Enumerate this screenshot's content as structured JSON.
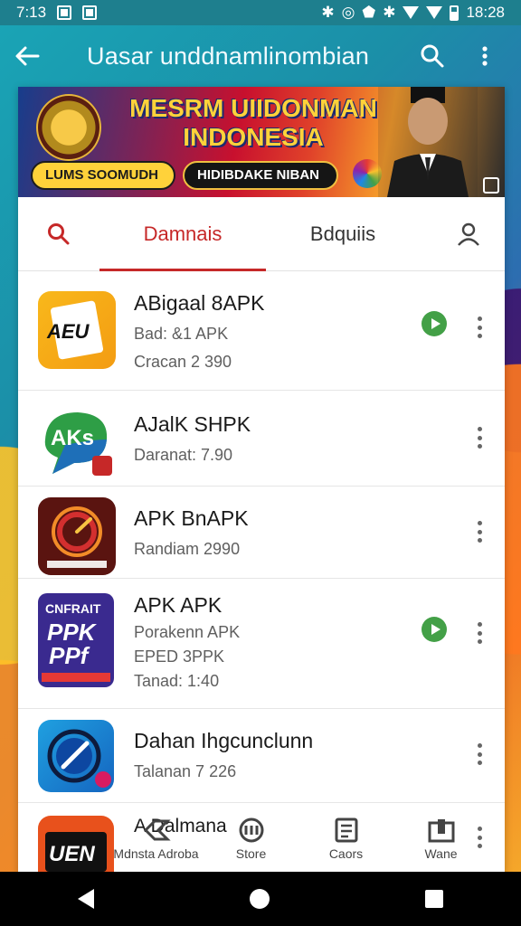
{
  "status_bar": {
    "time": "7:13",
    "clock": "18:28"
  },
  "app_bar": {
    "title": "Uasar unddnamlinombian"
  },
  "banner": {
    "title_line1": "MESRM UIIDONMAN",
    "title_line2": "INDONESIA",
    "chip_left": "LUMS SOOMUDH",
    "chip_right": "HIDIBDAKE NIBAN"
  },
  "tabs": [
    {
      "label": "Damnais"
    },
    {
      "label": "Bdquiis"
    }
  ],
  "apps": [
    {
      "name": "ABigaal 8APK",
      "sub1": "Bad: &1 APK",
      "sub2": "Cracan 2 390",
      "icon": "document-icon"
    },
    {
      "name": "AJalK SHPK",
      "sub1": "Daranat: 7.90",
      "icon": "akc-icon"
    },
    {
      "name": "APK BnAPK",
      "sub1": "Randiam 2990",
      "icon": "speedometer-icon"
    },
    {
      "name": "APK APK",
      "sub1": "Porakenn APK",
      "sub2": "EPED 3PPK",
      "sub3": "Tanad: 1:40",
      "icon": "pdf-icon"
    },
    {
      "name": "Dahan Ihgcunclunn",
      "sub1": "Talanan 7 226",
      "icon": "gauge-icon"
    },
    {
      "name": "A Dalmana",
      "icon": "uen-icon"
    }
  ],
  "bottom_tabs": [
    {
      "label": "Mdnsta Adroba"
    },
    {
      "label": "Store"
    },
    {
      "label": "Caors"
    },
    {
      "label": "Wane"
    }
  ],
  "colors": {
    "accent": "#c62828",
    "play": "#43a047",
    "appbar": "#1e7f8e"
  }
}
